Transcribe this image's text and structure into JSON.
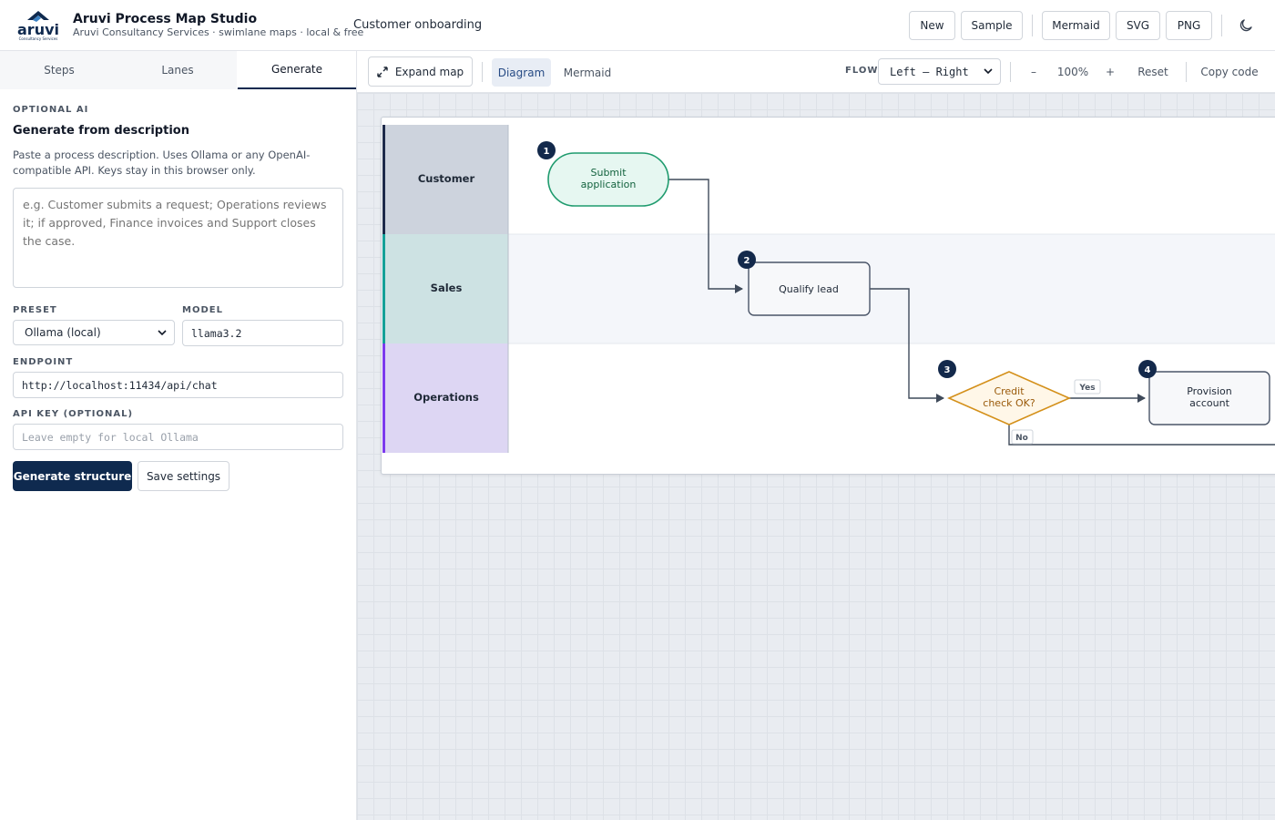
{
  "header": {
    "brand_logo_text": "aruvi",
    "brand_logo_subtext": "Consultancy Services",
    "app_title": "Aruvi Process Map Studio",
    "app_subtitle": "Aruvi Consultancy Services · swimlane maps · local & free",
    "document_title": "Customer onboarding",
    "buttons": {
      "new": "New",
      "sample": "Sample",
      "mermaid": "Mermaid",
      "svg": "SVG",
      "png": "PNG"
    },
    "theme_icon": "moon-icon"
  },
  "sidebar": {
    "tabs": [
      {
        "label": "Steps",
        "active": false
      },
      {
        "label": "Lanes",
        "active": false
      },
      {
        "label": "Generate",
        "active": true
      }
    ],
    "generate": {
      "eyebrow": "OPTIONAL AI",
      "title": "Generate from description",
      "description": "Paste a process description. Uses Ollama or any OpenAI-compatible API. Keys stay in this browser only.",
      "textarea_placeholder": "e.g. Customer submits a request; Operations reviews it; if approved, Finance invoices and Support closes the case.",
      "preset_label": "PRESET",
      "preset_value": "Ollama (local)",
      "model_label": "MODEL",
      "model_value": "llama3.2",
      "endpoint_label": "ENDPOINT",
      "endpoint_value": "http://localhost:11434/api/chat",
      "api_key_label": "API KEY (OPTIONAL)",
      "api_key_placeholder": "Leave empty for local Ollama",
      "generate_button": "Generate structure",
      "save_button": "Save settings"
    }
  },
  "toolbar": {
    "expand_label": "Expand map",
    "view_tabs": [
      {
        "label": "Diagram",
        "active": true
      },
      {
        "label": "Mermaid",
        "active": false
      }
    ],
    "flow_label": "FLOW",
    "flow_value": "Left — Right",
    "zoom_out": "–",
    "zoom_level": "100%",
    "zoom_in": "+",
    "reset": "Reset",
    "copy_code": "Copy code"
  },
  "diagram": {
    "lanes": [
      {
        "name": "Customer",
        "accent": "#1e2a4a",
        "fill": "#cdd3dd",
        "row_fill": "#ffffff"
      },
      {
        "name": "Sales",
        "accent": "#14a098",
        "fill": "#cde2e3",
        "row_fill": "#f4f6fa"
      },
      {
        "name": "Operations",
        "accent": "#7c3aed",
        "fill": "#ddd6f3",
        "row_fill": "#ffffff"
      }
    ],
    "steps": [
      {
        "number": "1",
        "label_lines": [
          "Submit",
          "application"
        ],
        "shape": "terminal",
        "lane": "Customer"
      },
      {
        "number": "2",
        "label_lines": [
          "Qualify lead"
        ],
        "shape": "process",
        "lane": "Sales"
      },
      {
        "number": "3",
        "label_lines": [
          "Credit",
          "check OK?"
        ],
        "shape": "decision",
        "lane": "Operations"
      },
      {
        "number": "4",
        "label_lines": [
          "Provision",
          "account"
        ],
        "shape": "process",
        "lane": "Operations"
      }
    ],
    "edge_labels": {
      "yes": "Yes",
      "no": "No"
    }
  }
}
